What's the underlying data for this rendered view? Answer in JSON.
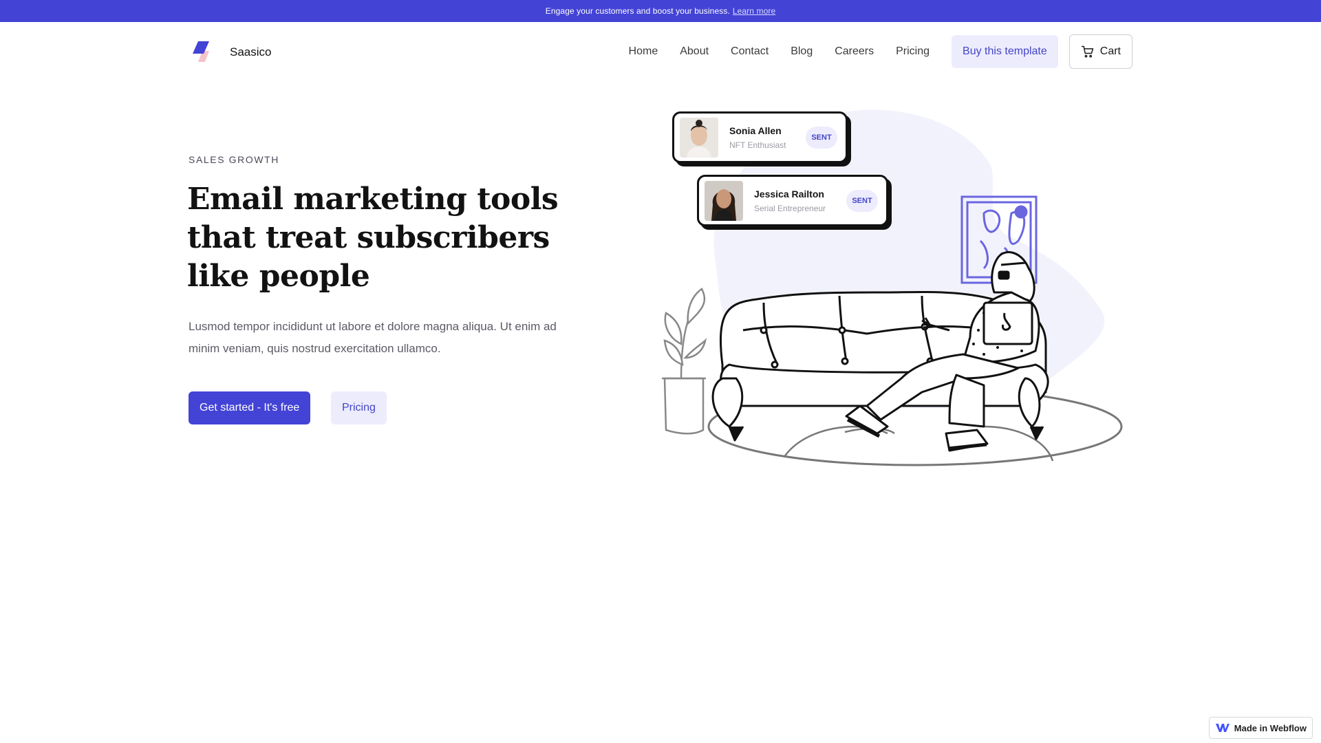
{
  "announcement": {
    "text": "Engage your customers and boost your business.",
    "link": "Learn more"
  },
  "brand": {
    "name": "Saasico"
  },
  "nav": {
    "links": [
      "Home",
      "About",
      "Contact",
      "Blog",
      "Careers",
      "Pricing"
    ],
    "buy_label": "Buy this template",
    "cart_label": "Cart"
  },
  "hero": {
    "eyebrow": "SALES GROWTH",
    "title": "Email marketing tools that treat subscribers like people",
    "subtitle": "Lusmod tempor incididunt ut labore et dolore magna aliqua. Ut enim ad minim veniam, quis nostrud exercitation ullamco.",
    "primary_cta": "Get started - It's free",
    "secondary_cta": "Pricing"
  },
  "cards": [
    {
      "name": "Sonia Allen",
      "role": "NFT Enthusiast",
      "status": "SENT"
    },
    {
      "name": "Jessica Railton",
      "role": "Serial Entrepreneur",
      "status": "SENT"
    }
  ],
  "badge": {
    "label": "Made in Webflow"
  },
  "colors": {
    "accent": "#4343d6",
    "accent_light": "#ececfd",
    "logo_pink": "#f5c4c8"
  }
}
